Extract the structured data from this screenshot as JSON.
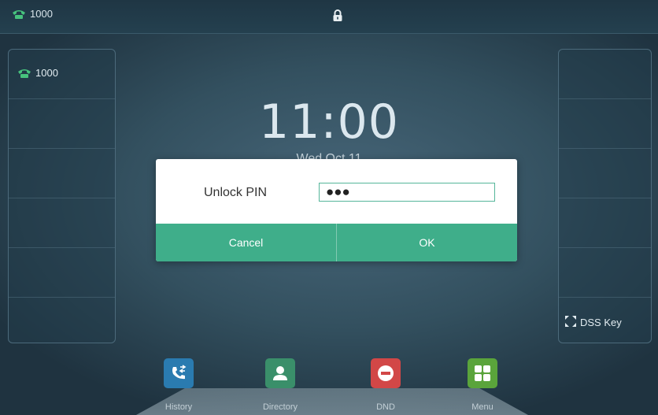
{
  "statusbar": {
    "line_label": "1000",
    "icons": [
      "phone-icon",
      "lock-icon"
    ]
  },
  "left_panel": {
    "line_key_label": "1000"
  },
  "right_panel": {
    "dss_key_label": "DSS Key"
  },
  "home": {
    "time": "11:00",
    "date": "Wed Oct 11"
  },
  "unlock_dialog": {
    "label": "Unlock PIN",
    "pin_value": "●●●",
    "cancel_label": "Cancel",
    "ok_label": "OK"
  },
  "softkeys": [
    {
      "label": "History",
      "icon": "history-icon",
      "color": "#2a7bb0"
    },
    {
      "label": "Directory",
      "icon": "directory-icon",
      "color": "#3a8f6a"
    },
    {
      "label": "DND",
      "icon": "dnd-icon",
      "color": "#d24747"
    },
    {
      "label": "Menu",
      "icon": "menu-icon",
      "color": "#5aa43b"
    }
  ],
  "colors": {
    "accent_green": "#3fae8a",
    "line_icon_green": "#47c27d"
  }
}
